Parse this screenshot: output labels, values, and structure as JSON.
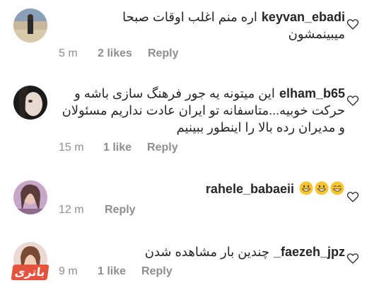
{
  "comments": [
    {
      "username": "keyvan_ebadi",
      "text_line1": "اره منم اغلب اوقات صبحا",
      "text_line2": "میبینمشون",
      "time": "5 m",
      "likes": "2 likes",
      "reply": "Reply"
    },
    {
      "username": "elham_b65",
      "text_line1": "این میتونه یه جور فرهنگ سازی باشه و",
      "text_line2": "حرکت خوبیه...متاسفانه تو ایران عادت نداریم مسئولان",
      "text_line3": "و مدیران رده بالا را اینطور ببینیم",
      "time": "15 m",
      "likes": "1 like",
      "reply": "Reply"
    },
    {
      "username": "rahele_babaeii",
      "emojis": [
        "grinning-face-emoji",
        "grinning-face-emoji",
        "smiling-eyes-emoji"
      ],
      "time": "12 m",
      "reply": "Reply"
    },
    {
      "username": "_faezeh_jpz",
      "text_line1": "چندین بار مشاهده شدن",
      "time": "9 m",
      "likes": "1 like",
      "reply": "Reply"
    }
  ],
  "icons": {
    "heart": "heart-outline-icon"
  },
  "colors": {
    "text": "#262626",
    "meta": "#8e8e8e",
    "emoji": "#f7c531",
    "watermark": "#e5533d"
  },
  "watermark": "باتری"
}
